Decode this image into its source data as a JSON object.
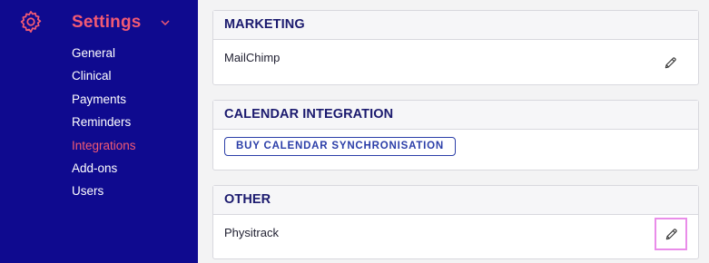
{
  "sidebar": {
    "section_title": "Settings",
    "section_icon": "gear-icon",
    "items": [
      {
        "label": "General"
      },
      {
        "label": "Clinical"
      },
      {
        "label": "Payments"
      },
      {
        "label": "Reminders"
      },
      {
        "label": "Integrations",
        "active": true
      },
      {
        "label": "Add-ons"
      },
      {
        "label": "Users"
      }
    ],
    "colors": {
      "background": "#0f0a8f",
      "accent": "#f25a74",
      "text": "#ffffff"
    }
  },
  "sections": {
    "marketing": {
      "title": "MARKETING",
      "item_label": "MailChimp",
      "edit_icon": "pencil-icon"
    },
    "calendar": {
      "title": "CALENDAR INTEGRATION",
      "button_label": "BUY CALENDAR SYNCHRONISATION"
    },
    "other": {
      "title": "OTHER",
      "item_label": "Physitrack",
      "edit_icon": "pencil-icon",
      "edit_highlighted": true
    }
  },
  "colors": {
    "header_text": "#1b1a6e",
    "button": "#2b3ea8",
    "highlight": "#e98de9"
  }
}
